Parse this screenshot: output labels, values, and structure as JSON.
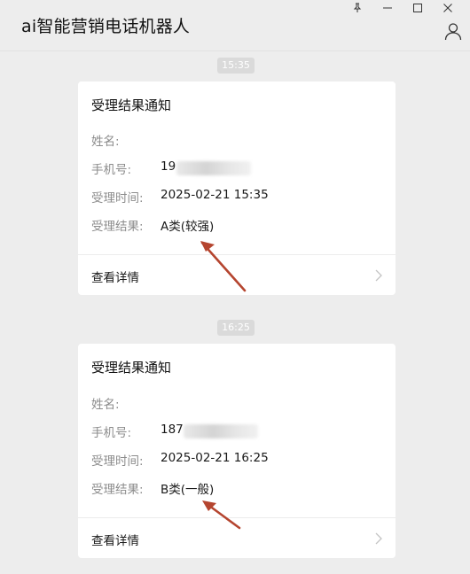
{
  "window": {
    "title": "ai智能营销电话机器人",
    "controls": {
      "pin": "⚲",
      "minimize": "—",
      "maximize": "☐",
      "close": "✕"
    }
  },
  "messages": [
    {
      "time": "15:35",
      "card": {
        "title": "受理结果通知",
        "fields": [
          {
            "label": "姓名:",
            "value": ""
          },
          {
            "label": "手机号:",
            "value": "19"
          },
          {
            "label": "受理时间:",
            "value": "2025-02-21 15:35"
          },
          {
            "label": "受理结果:",
            "value": "A类(较强)"
          }
        ],
        "link": "查看详情"
      }
    },
    {
      "time": "16:25",
      "card": {
        "title": "受理结果通知",
        "fields": [
          {
            "label": "姓名:",
            "value": ""
          },
          {
            "label": "手机号:",
            "value": "187"
          },
          {
            "label": "受理时间:",
            "value": "2025-02-21 16:25"
          },
          {
            "label": "受理结果:",
            "value": "B类(一般)"
          }
        ],
        "link": "查看详情"
      }
    }
  ],
  "colors": {
    "background": "#ededed",
    "card": "#ffffff",
    "label": "#8c8c8c",
    "annotation_arrow": "#b5452f"
  },
  "icons": {
    "pin": "pin-icon",
    "minimize": "minimize-icon",
    "maximize": "maximize-icon",
    "close": "close-icon",
    "user": "user-icon",
    "chevron": "chevron-right-icon"
  }
}
